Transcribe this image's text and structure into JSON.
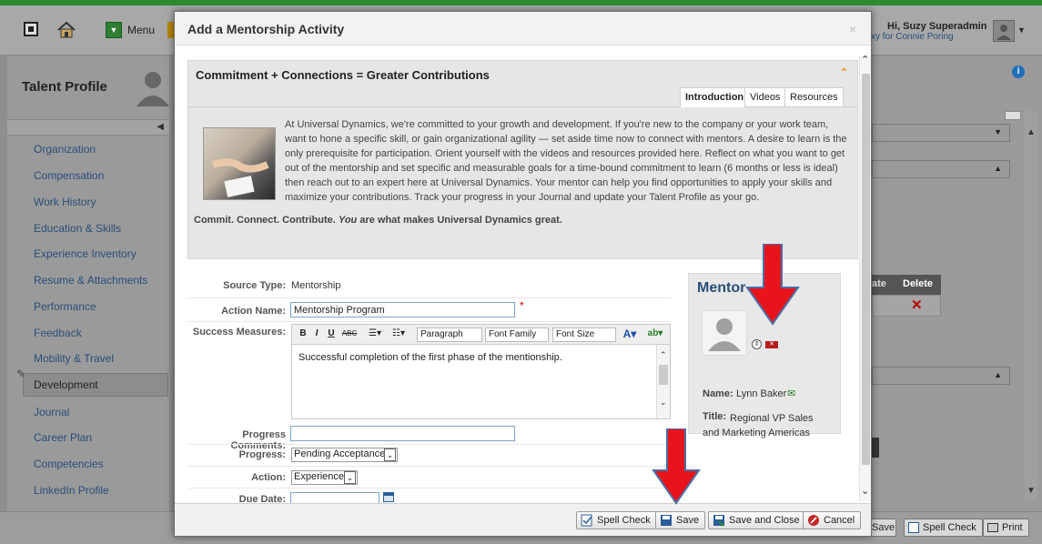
{
  "header": {
    "menu_label": "Menu",
    "greeting": "Hi, Suzy Superadmin",
    "proxy_text": "xy for Connie Poring"
  },
  "sidebar": {
    "title": "Talent Profile",
    "items": [
      {
        "label": "Organization"
      },
      {
        "label": "Compensation"
      },
      {
        "label": "Work History"
      },
      {
        "label": "Education & Skills"
      },
      {
        "label": "Experience Inventory"
      },
      {
        "label": "Resume & Attachments"
      },
      {
        "label": "Performance"
      },
      {
        "label": "Feedback"
      },
      {
        "label": "Mobility & Travel"
      },
      {
        "label": "Development"
      },
      {
        "label": "Journal"
      },
      {
        "label": "Career Plan"
      },
      {
        "label": "Competencies"
      },
      {
        "label": "LinkedIn Profile"
      }
    ]
  },
  "background_table": {
    "col_partial": "ate",
    "col_delete": "Delete"
  },
  "modal": {
    "title": "Add a Mentorship Activity",
    "close": "×",
    "panel": {
      "title": "Commitment + Connections = Greater Contributions",
      "tabs": [
        {
          "label": "Introduction"
        },
        {
          "label": "Videos"
        },
        {
          "label": "Resources"
        }
      ],
      "intro": "At Universal Dynamics, we're committed to your growth and development. If you're new to the company or your work team, want to hone a specific skill, or gain organizational agility — set aside time now to connect with mentors. A desire to learn is the only prerequisite for participation. Orient yourself with the videos and resources provided here. Reflect on what you want to get out of the mentorship and set specific and measurable goals for a time-bound commitment to learn (6 months or less is ideal) then reach out to an expert here at Universal Dynamics. Your mentor can help you find opportunities to apply your skills and maximize your contributions. Track your progress in your Journal and update your Talent Profile as your go.",
      "commit_a": "Commit. Connect. Contribute. ",
      "commit_b": "You",
      "commit_c": " are what makes Universal Dynamics great."
    },
    "form": {
      "source_type_label": "Source Type:",
      "source_type_value": "Mentorship",
      "action_name_label": "Action Name:",
      "action_name_value": "Mentorship Program",
      "required_mark": "*",
      "success_label": "Success Measures:",
      "editor": {
        "bold": "B",
        "italic": "I",
        "underline": "U",
        "strike": "ABC",
        "paragraph": "Paragraph",
        "font_family": "Font Family",
        "font_size": "Font Size",
        "text": "Successful completion of the first phase of the mentionship."
      },
      "progress_comments_label": "Progress Comments:",
      "progress_comments_value": "",
      "progress_label": "Progress:",
      "progress_value": "Pending Acceptance",
      "action_label": "Action:",
      "action_value": "Experience",
      "due_date_label": "Due Date:"
    },
    "mentor": {
      "heading": "Mentor",
      "name_label": "Name:",
      "name_value": "Lynn Baker",
      "title_label": "Title:",
      "title_value": "Regional VP Sales and Marketing Americas"
    },
    "footer": {
      "spell_check": "Spell Check",
      "save": "Save",
      "save_close": "Save and Close",
      "cancel": "Cancel"
    }
  },
  "bottom_bar": {
    "save_partial": "Save",
    "spell_check": "Spell Check",
    "print": "Print"
  },
  "colors": {
    "accent_green": "#2e8b2e",
    "link_blue": "#2a4f7a",
    "arrow_red": "#e8141c"
  }
}
